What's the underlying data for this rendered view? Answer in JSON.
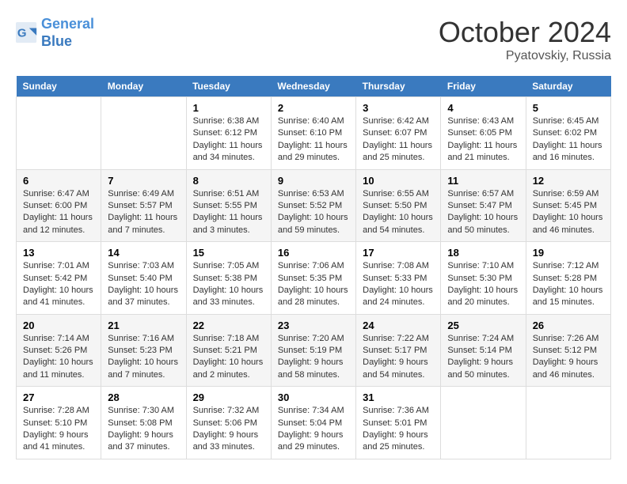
{
  "header": {
    "logo_line1": "General",
    "logo_line2": "Blue",
    "month": "October 2024",
    "location": "Pyatovskiy, Russia"
  },
  "days_of_week": [
    "Sunday",
    "Monday",
    "Tuesday",
    "Wednesday",
    "Thursday",
    "Friday",
    "Saturday"
  ],
  "weeks": [
    [
      {
        "day": "",
        "info": ""
      },
      {
        "day": "",
        "info": ""
      },
      {
        "day": "1",
        "info": "Sunrise: 6:38 AM\nSunset: 6:12 PM\nDaylight: 11 hours and 34 minutes."
      },
      {
        "day": "2",
        "info": "Sunrise: 6:40 AM\nSunset: 6:10 PM\nDaylight: 11 hours and 29 minutes."
      },
      {
        "day": "3",
        "info": "Sunrise: 6:42 AM\nSunset: 6:07 PM\nDaylight: 11 hours and 25 minutes."
      },
      {
        "day": "4",
        "info": "Sunrise: 6:43 AM\nSunset: 6:05 PM\nDaylight: 11 hours and 21 minutes."
      },
      {
        "day": "5",
        "info": "Sunrise: 6:45 AM\nSunset: 6:02 PM\nDaylight: 11 hours and 16 minutes."
      }
    ],
    [
      {
        "day": "6",
        "info": "Sunrise: 6:47 AM\nSunset: 6:00 PM\nDaylight: 11 hours and 12 minutes."
      },
      {
        "day": "7",
        "info": "Sunrise: 6:49 AM\nSunset: 5:57 PM\nDaylight: 11 hours and 7 minutes."
      },
      {
        "day": "8",
        "info": "Sunrise: 6:51 AM\nSunset: 5:55 PM\nDaylight: 11 hours and 3 minutes."
      },
      {
        "day": "9",
        "info": "Sunrise: 6:53 AM\nSunset: 5:52 PM\nDaylight: 10 hours and 59 minutes."
      },
      {
        "day": "10",
        "info": "Sunrise: 6:55 AM\nSunset: 5:50 PM\nDaylight: 10 hours and 54 minutes."
      },
      {
        "day": "11",
        "info": "Sunrise: 6:57 AM\nSunset: 5:47 PM\nDaylight: 10 hours and 50 minutes."
      },
      {
        "day": "12",
        "info": "Sunrise: 6:59 AM\nSunset: 5:45 PM\nDaylight: 10 hours and 46 minutes."
      }
    ],
    [
      {
        "day": "13",
        "info": "Sunrise: 7:01 AM\nSunset: 5:42 PM\nDaylight: 10 hours and 41 minutes."
      },
      {
        "day": "14",
        "info": "Sunrise: 7:03 AM\nSunset: 5:40 PM\nDaylight: 10 hours and 37 minutes."
      },
      {
        "day": "15",
        "info": "Sunrise: 7:05 AM\nSunset: 5:38 PM\nDaylight: 10 hours and 33 minutes."
      },
      {
        "day": "16",
        "info": "Sunrise: 7:06 AM\nSunset: 5:35 PM\nDaylight: 10 hours and 28 minutes."
      },
      {
        "day": "17",
        "info": "Sunrise: 7:08 AM\nSunset: 5:33 PM\nDaylight: 10 hours and 24 minutes."
      },
      {
        "day": "18",
        "info": "Sunrise: 7:10 AM\nSunset: 5:30 PM\nDaylight: 10 hours and 20 minutes."
      },
      {
        "day": "19",
        "info": "Sunrise: 7:12 AM\nSunset: 5:28 PM\nDaylight: 10 hours and 15 minutes."
      }
    ],
    [
      {
        "day": "20",
        "info": "Sunrise: 7:14 AM\nSunset: 5:26 PM\nDaylight: 10 hours and 11 minutes."
      },
      {
        "day": "21",
        "info": "Sunrise: 7:16 AM\nSunset: 5:23 PM\nDaylight: 10 hours and 7 minutes."
      },
      {
        "day": "22",
        "info": "Sunrise: 7:18 AM\nSunset: 5:21 PM\nDaylight: 10 hours and 2 minutes."
      },
      {
        "day": "23",
        "info": "Sunrise: 7:20 AM\nSunset: 5:19 PM\nDaylight: 9 hours and 58 minutes."
      },
      {
        "day": "24",
        "info": "Sunrise: 7:22 AM\nSunset: 5:17 PM\nDaylight: 9 hours and 54 minutes."
      },
      {
        "day": "25",
        "info": "Sunrise: 7:24 AM\nSunset: 5:14 PM\nDaylight: 9 hours and 50 minutes."
      },
      {
        "day": "26",
        "info": "Sunrise: 7:26 AM\nSunset: 5:12 PM\nDaylight: 9 hours and 46 minutes."
      }
    ],
    [
      {
        "day": "27",
        "info": "Sunrise: 7:28 AM\nSunset: 5:10 PM\nDaylight: 9 hours and 41 minutes."
      },
      {
        "day": "28",
        "info": "Sunrise: 7:30 AM\nSunset: 5:08 PM\nDaylight: 9 hours and 37 minutes."
      },
      {
        "day": "29",
        "info": "Sunrise: 7:32 AM\nSunset: 5:06 PM\nDaylight: 9 hours and 33 minutes."
      },
      {
        "day": "30",
        "info": "Sunrise: 7:34 AM\nSunset: 5:04 PM\nDaylight: 9 hours and 29 minutes."
      },
      {
        "day": "31",
        "info": "Sunrise: 7:36 AM\nSunset: 5:01 PM\nDaylight: 9 hours and 25 minutes."
      },
      {
        "day": "",
        "info": ""
      },
      {
        "day": "",
        "info": ""
      }
    ]
  ]
}
